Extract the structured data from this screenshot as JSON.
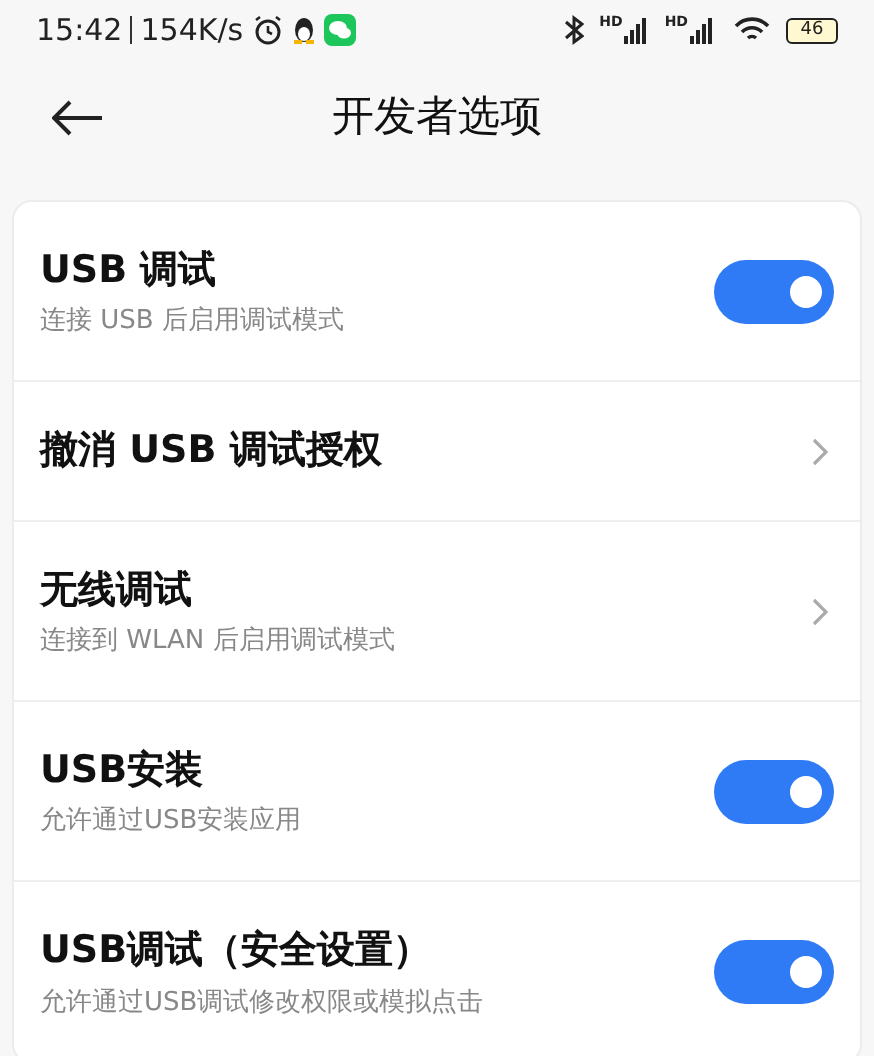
{
  "status_bar": {
    "time": "15:42",
    "speed": "154K/s",
    "signal_labels": [
      "HD",
      "HD"
    ],
    "battery": "46"
  },
  "header": {
    "title": "开发者选项"
  },
  "items": [
    {
      "kind": "toggle",
      "title": "USB 调试",
      "subtitle": "连接 USB 后启用调试模式",
      "on": true
    },
    {
      "kind": "link",
      "title": "撤消 USB 调试授权"
    },
    {
      "kind": "link",
      "title": "无线调试",
      "subtitle": "连接到 WLAN 后启用调试模式"
    },
    {
      "kind": "toggle",
      "title": "USB安装",
      "subtitle": "允许通过USB安装应用",
      "on": true
    },
    {
      "kind": "toggle",
      "title": "USB调试（安全设置）",
      "subtitle": "允许通过USB调试修改权限或模拟点击",
      "on": true
    }
  ]
}
